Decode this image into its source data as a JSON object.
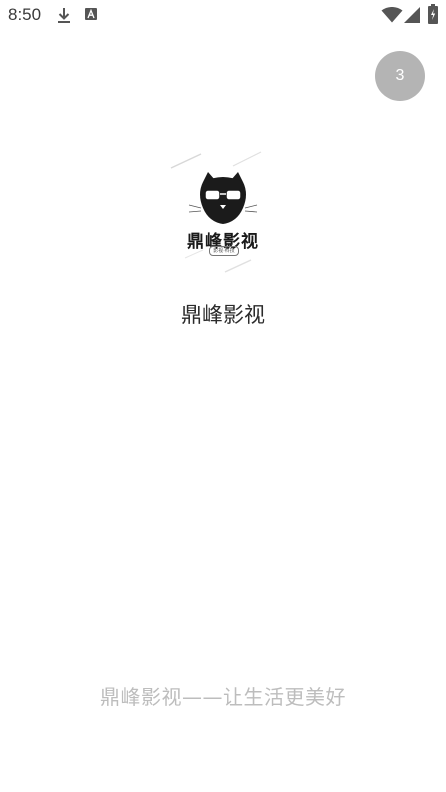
{
  "status_bar": {
    "time": "8:50",
    "icons": [
      "download-icon",
      "text-a-icon",
      "wifi-icon",
      "cell-signal-icon",
      "battery-charging-icon"
    ]
  },
  "countdown": {
    "seconds": "3",
    "color": "#b4b4b4"
  },
  "logo": {
    "text": "鼎峰影视",
    "badge": "影视·科技",
    "icon": "cat-with-glasses-logo"
  },
  "app_name": "鼎峰影视",
  "slogan": "鼎峰影视——让生活更美好"
}
